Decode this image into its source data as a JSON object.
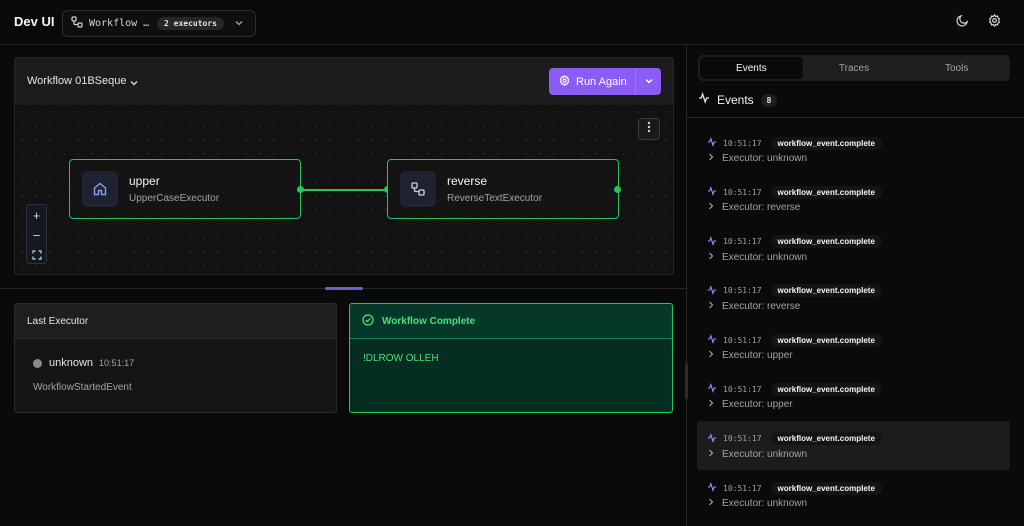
{
  "app": {
    "title": "Dev UI"
  },
  "workflow_selector": {
    "name": "Workflow …",
    "badge": "2 executors"
  },
  "header_icons": [
    "moon-icon",
    "gear-icon"
  ],
  "canvas": {
    "workflow_title": "Workflow 01BSeque",
    "run_button": {
      "label": "Run Again"
    },
    "nodes": [
      {
        "title": "upper",
        "subtitle": "UpperCaseExecutor",
        "icon": "home-icon"
      },
      {
        "title": "reverse",
        "subtitle": "ReverseTextExecutor",
        "icon": "workflow-icon"
      }
    ],
    "zoom_controls": [
      "+",
      "−",
      "⛶"
    ]
  },
  "last_executor": {
    "title": "Last Executor",
    "name": "unknown",
    "time": "10:51:17",
    "event": "WorkflowStartedEvent"
  },
  "workflow_complete": {
    "title": "Workflow Complete",
    "output": "!DLROW OLLEH"
  },
  "right_panel": {
    "tabs": [
      {
        "label": "Events",
        "active": true
      },
      {
        "label": "Traces",
        "active": false
      },
      {
        "label": "Tools",
        "active": false
      }
    ],
    "events_title": "Events",
    "events_count": "8",
    "events": [
      {
        "time": "10:51:17",
        "type": "workflow_event.complete",
        "detail": "Executor: unknown",
        "highlighted": false
      },
      {
        "time": "10:51:17",
        "type": "workflow_event.complete",
        "detail": "Executor: reverse",
        "highlighted": false
      },
      {
        "time": "10:51:17",
        "type": "workflow_event.complete",
        "detail": "Executor: unknown",
        "highlighted": false
      },
      {
        "time": "10:51:17",
        "type": "workflow_event.complete",
        "detail": "Executor: reverse",
        "highlighted": false
      },
      {
        "time": "10:51:17",
        "type": "workflow_event.complete",
        "detail": "Executor: upper",
        "highlighted": false
      },
      {
        "time": "10:51:17",
        "type": "workflow_event.complete",
        "detail": "Executor: upper",
        "highlighted": false
      },
      {
        "time": "10:51:17",
        "type": "workflow_event.complete",
        "detail": "Executor: unknown",
        "highlighted": true
      },
      {
        "time": "10:51:17",
        "type": "workflow_event.complete",
        "detail": "Executor: unknown",
        "highlighted": false
      }
    ]
  },
  "colors": {
    "accent": "#8b5cf6",
    "success": "#22c55e",
    "background": "#0a0a0a"
  }
}
